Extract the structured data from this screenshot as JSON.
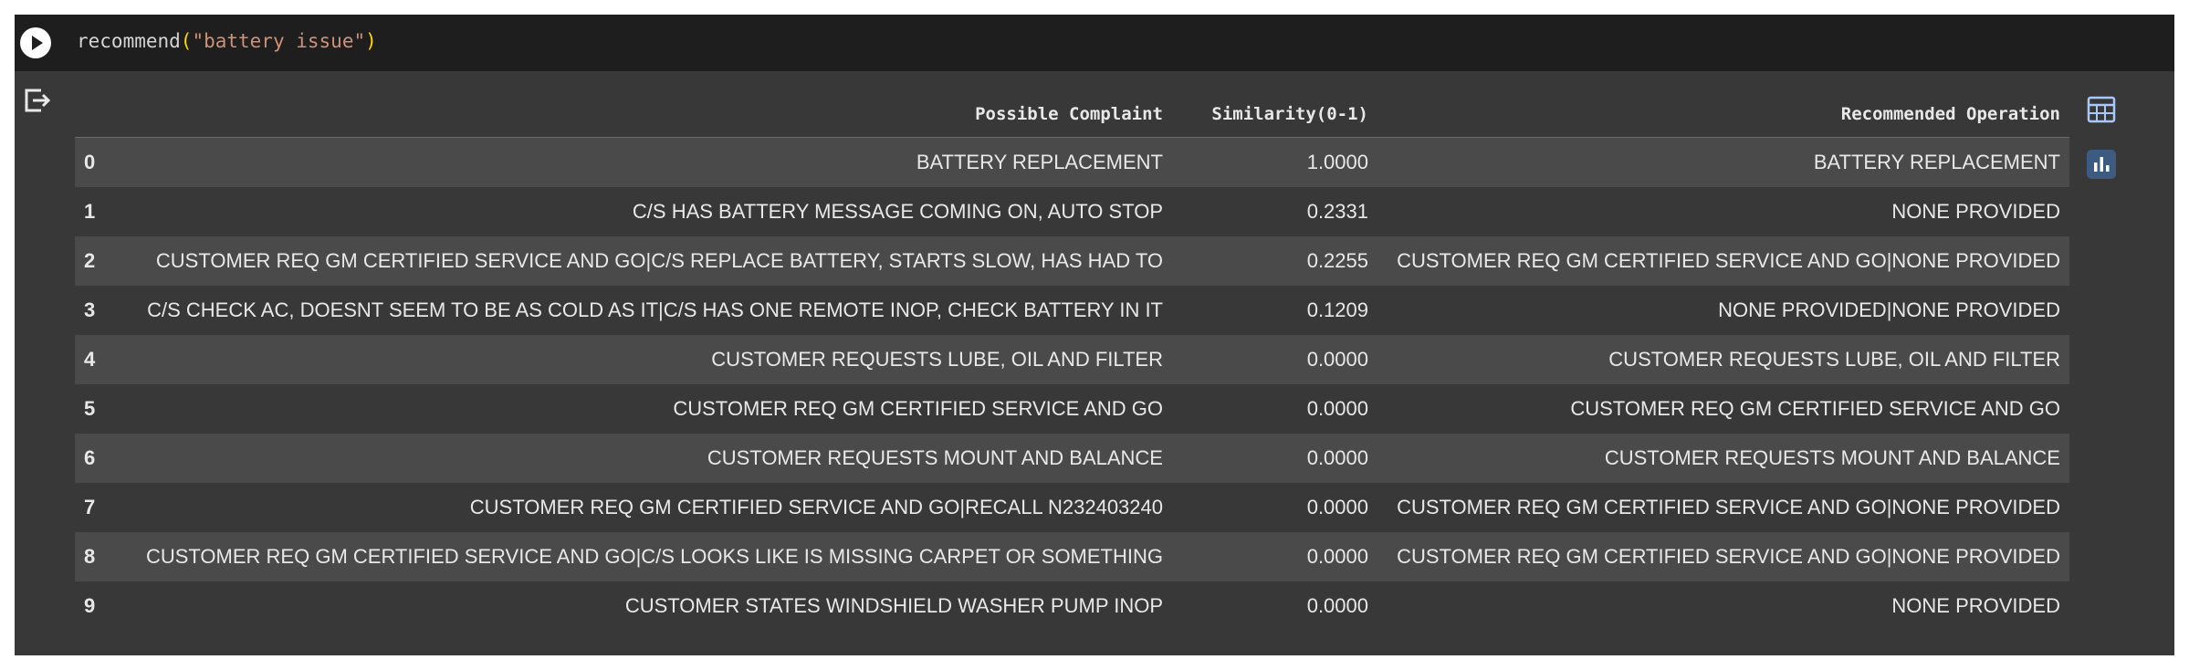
{
  "code": {
    "func": "recommend",
    "open_paren": "(",
    "arg": "\"battery issue\"",
    "close_paren": ")"
  },
  "icons": {
    "run": "play-circle-icon",
    "output": "output-clear-icon",
    "table_view": "table-icon",
    "chart_suggest": "bar-chart-icon"
  },
  "colors": {
    "cell_bg": "#383838",
    "code_bg": "#1e1e1e",
    "row_alt_bg": "#4a4a4a",
    "string": "#ce9178",
    "chart_icon_bg": "#3d5a80"
  },
  "table": {
    "columns": [
      "",
      "Possible Complaint",
      "Similarity(0-1)",
      "Recommended Operation"
    ],
    "rows": [
      {
        "index": "0",
        "complaint": "BATTERY REPLACEMENT",
        "similarity": "1.0000",
        "operation": "BATTERY REPLACEMENT"
      },
      {
        "index": "1",
        "complaint": "C/S HAS BATTERY MESSAGE COMING ON, AUTO STOP",
        "similarity": "0.2331",
        "operation": "NONE PROVIDED"
      },
      {
        "index": "2",
        "complaint": "CUSTOMER REQ GM CERTIFIED SERVICE AND GO|C/S REPLACE BATTERY, STARTS SLOW, HAS HAD TO",
        "similarity": "0.2255",
        "operation": "CUSTOMER REQ GM CERTIFIED SERVICE AND GO|NONE PROVIDED"
      },
      {
        "index": "3",
        "complaint": "C/S CHECK AC, DOESNT SEEM TO BE AS COLD AS IT|C/S HAS ONE REMOTE INOP, CHECK BATTERY IN IT",
        "similarity": "0.1209",
        "operation": "NONE PROVIDED|NONE PROVIDED"
      },
      {
        "index": "4",
        "complaint": "CUSTOMER REQUESTS LUBE, OIL AND FILTER",
        "similarity": "0.0000",
        "operation": "CUSTOMER REQUESTS LUBE, OIL AND FILTER"
      },
      {
        "index": "5",
        "complaint": "CUSTOMER REQ GM CERTIFIED SERVICE AND GO",
        "similarity": "0.0000",
        "operation": "CUSTOMER REQ GM CERTIFIED SERVICE AND GO"
      },
      {
        "index": "6",
        "complaint": "CUSTOMER REQUESTS MOUNT AND BALANCE",
        "similarity": "0.0000",
        "operation": "CUSTOMER REQUESTS MOUNT AND BALANCE"
      },
      {
        "index": "7",
        "complaint": "CUSTOMER REQ GM CERTIFIED SERVICE AND GO|RECALL N232403240",
        "similarity": "0.0000",
        "operation": "CUSTOMER REQ GM CERTIFIED SERVICE AND GO|NONE PROVIDED"
      },
      {
        "index": "8",
        "complaint": "CUSTOMER REQ GM CERTIFIED SERVICE AND GO|C/S LOOKS LIKE IS MISSING CARPET OR SOMETHING",
        "similarity": "0.0000",
        "operation": "CUSTOMER REQ GM CERTIFIED SERVICE AND GO|NONE PROVIDED"
      },
      {
        "index": "9",
        "complaint": "CUSTOMER STATES WINDSHIELD WASHER PUMP INOP",
        "similarity": "0.0000",
        "operation": "NONE PROVIDED"
      }
    ]
  }
}
